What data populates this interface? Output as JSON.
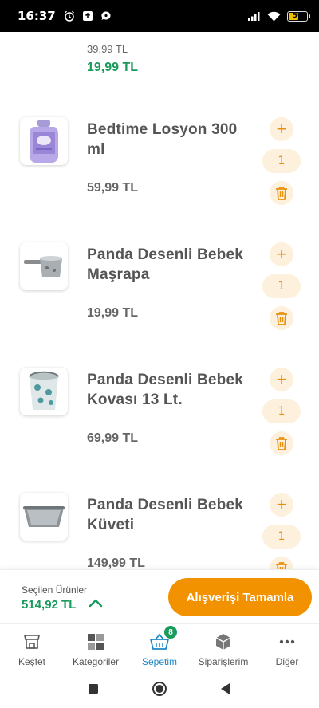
{
  "status_bar": {
    "time": "16:37",
    "battery_level": "56",
    "battery_fraction": 0.56
  },
  "partial_item": {
    "old_price": "39,99 TL",
    "new_price": "19,99 TL"
  },
  "cart_items": [
    {
      "name": "Bedtime Losyon 300 ml",
      "price": "59,99 TL",
      "quantity": "1",
      "image_icon": "lotion-bottle-image"
    },
    {
      "name": "Panda Desenli Bebek Maşrapa",
      "price": "19,99 TL",
      "quantity": "1",
      "image_icon": "baby-scoop-image"
    },
    {
      "name": "Panda Desenli Bebek Kovası 13 Lt.",
      "price": "69,99 TL",
      "quantity": "1",
      "image_icon": "baby-bucket-image"
    },
    {
      "name": "Panda Desenli Bebek Küveti",
      "price": "149,99 TL",
      "quantity": "1",
      "image_icon": "baby-bathtub-image"
    }
  ],
  "summary": {
    "label": "Seçilen Ürünler",
    "total": "514,92 TL",
    "checkout_label": "Alışverişi Tamamla"
  },
  "bottom_nav": {
    "items": [
      {
        "label": "Keşfet",
        "icon": "storefront-icon"
      },
      {
        "label": "Kategoriler",
        "icon": "grid-icon"
      },
      {
        "label": "Sepetim",
        "icon": "basket-icon",
        "badge": "8",
        "active": true
      },
      {
        "label": "Siparişlerim",
        "icon": "package-icon"
      },
      {
        "label": "Diğer",
        "icon": "more-dots-icon"
      }
    ]
  },
  "colors": {
    "accent_orange": "#f39200",
    "price_green": "#1a9a5c",
    "active_blue": "#1e88c8",
    "qty_background": "#fdf1de"
  }
}
